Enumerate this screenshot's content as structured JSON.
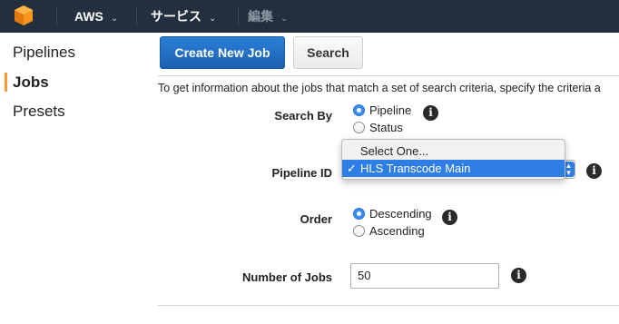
{
  "topnav": {
    "brand_icon": "aws-cube-icon",
    "items": [
      {
        "label": "AWS",
        "chevron": "⌄"
      },
      {
        "label": "サービス",
        "chevron": "⌄"
      },
      {
        "label": "編集",
        "chevron": "⌄"
      }
    ],
    "bg_color": "#232f3e"
  },
  "sidebar": {
    "items": [
      {
        "label": "Pipelines",
        "active": false
      },
      {
        "label": "Jobs",
        "active": true
      },
      {
        "label": "Presets",
        "active": false
      }
    ],
    "accent_color": "#f19e39"
  },
  "toolbar": {
    "create_label": "Create New Job",
    "search_label": "Search",
    "primary_color": "#1b62b3"
  },
  "intro_text": "To get information about the jobs that match a set of search criteria, specify the criteria a",
  "form": {
    "search_by": {
      "label": "Search By",
      "options": [
        "Pipeline",
        "Status"
      ],
      "selected": "Pipeline"
    },
    "pipeline_id": {
      "label": "Pipeline ID",
      "options": [
        "Select One...",
        "HLS Transcode Main"
      ],
      "selected": "HLS Transcode Main",
      "check_glyph": "✓"
    },
    "order": {
      "label": "Order",
      "options": [
        "Descending",
        "Ascending"
      ],
      "selected": "Descending"
    },
    "number_of_jobs": {
      "label": "Number of Jobs",
      "value": "50"
    },
    "info_glyph": "i"
  }
}
